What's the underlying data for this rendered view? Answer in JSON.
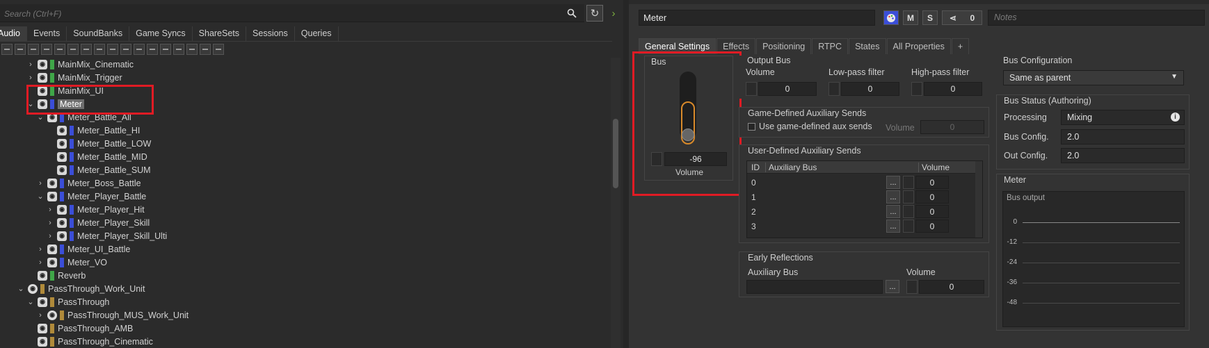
{
  "search": {
    "placeholder": "Search (Ctrl+F)"
  },
  "left_tabs": [
    "Audio",
    "Events",
    "SoundBanks",
    "Game Syncs",
    "ShareSets",
    "Sessions",
    "Queries"
  ],
  "tree": [
    {
      "label": "MainMix_Cinematic",
      "chev": "›",
      "color": "#3fa648"
    },
    {
      "label": "MainMix_Trigger",
      "chev": "›",
      "color": "#3fa648"
    },
    {
      "label": "MainMix_UI",
      "chev": "",
      "color": "#3fa648"
    },
    {
      "label": "Meter",
      "chev": "⌄",
      "color": "#3b4ed8"
    },
    {
      "label": "Meter_Battle_All",
      "chev": "⌄",
      "color": "#3b4ed8"
    },
    {
      "label": "Meter_Battle_HI",
      "chev": "",
      "color": "#3b4ed8"
    },
    {
      "label": "Meter_Battle_LOW",
      "chev": "",
      "color": "#3b4ed8"
    },
    {
      "label": "Meter_Battle_MID",
      "chev": "",
      "color": "#3b4ed8"
    },
    {
      "label": "Meter_Battle_SUM",
      "chev": "",
      "color": "#3b4ed8"
    },
    {
      "label": "Meter_Boss_Battle",
      "chev": "›",
      "color": "#3b4ed8"
    },
    {
      "label": "Meter_Player_Battle",
      "chev": "⌄",
      "color": "#3b4ed8"
    },
    {
      "label": "Meter_Player_Hit",
      "chev": "›",
      "color": "#3b4ed8"
    },
    {
      "label": "Meter_Player_Skill",
      "chev": "›",
      "color": "#3b4ed8"
    },
    {
      "label": "Meter_Player_Skill_Ulti",
      "chev": "›",
      "color": "#3b4ed8"
    },
    {
      "label": "Meter_UI_Battle",
      "chev": "›",
      "color": "#3b4ed8"
    },
    {
      "label": "Meter_VO",
      "chev": "›",
      "color": "#3b4ed8"
    },
    {
      "label": "Reverb",
      "chev": "",
      "color": "#3fa648"
    },
    {
      "label": "PassThrough_Work_Unit",
      "chev": "⌄",
      "color": "#b08a3a"
    },
    {
      "label": "PassThrough",
      "chev": "⌄",
      "color": "#b08a3a"
    },
    {
      "label": "PassThrough_MUS_Work_Unit",
      "chev": "›",
      "color": "#b08a3a"
    },
    {
      "label": "PassThrough_AMB",
      "chev": "",
      "color": "#b08a3a"
    },
    {
      "label": "PassThrough_Cinematic",
      "chev": "",
      "color": "#b08a3a"
    }
  ],
  "header": {
    "object_name": "Meter",
    "mute": "M",
    "solo": "S",
    "share_count": "0",
    "notes_placeholder": "Notes"
  },
  "right_tabs": [
    "General Settings",
    "Effects",
    "Positioning",
    "RTPC",
    "States",
    "All Properties",
    "+"
  ],
  "bus_group": {
    "title": "Bus",
    "volume_value": "-96",
    "volume_label": "Volume"
  },
  "output_bus": {
    "title": "Output Bus",
    "volume_label": "Volume",
    "volume_value": "0",
    "lpf_label": "Low-pass filter",
    "lpf_value": "0",
    "hpf_label": "High-pass filter",
    "hpf_value": "0"
  },
  "game_aux": {
    "title": "Game-Defined Auxiliary Sends",
    "checkbox_label": "Use game-defined aux sends",
    "volume_label": "Volume",
    "volume_value": "0"
  },
  "user_aux": {
    "title": "User-Defined Auxiliary Sends",
    "col_id": "ID",
    "col_bus": "Auxiliary Bus",
    "col_volume": "Volume",
    "rows": [
      {
        "id": "0",
        "dots": "...",
        "volume": "0"
      },
      {
        "id": "1",
        "dots": "...",
        "volume": "0"
      },
      {
        "id": "2",
        "dots": "...",
        "volume": "0"
      },
      {
        "id": "3",
        "dots": "...",
        "volume": "0"
      }
    ]
  },
  "early_reflections": {
    "title": "Early Reflections",
    "aux_label": "Auxiliary Bus",
    "volume_label": "Volume",
    "dots": "...",
    "volume_value": "0"
  },
  "bus_config": {
    "title": "Bus Configuration",
    "value": "Same as parent"
  },
  "bus_status": {
    "title": "Bus Status (Authoring)",
    "processing_label": "Processing",
    "processing_value": "Mixing",
    "busconfig_label": "Bus Config.",
    "busconfig_value": "2.0",
    "outconfig_label": "Out Config.",
    "outconfig_value": "2.0"
  },
  "meter": {
    "title": "Meter",
    "output_label": "Bus output",
    "ticks": [
      "0",
      "-12",
      "-24",
      "-36",
      "-48"
    ]
  },
  "colors": {
    "highlight": "#e01b24",
    "fader_accent": "#d98a2a"
  }
}
